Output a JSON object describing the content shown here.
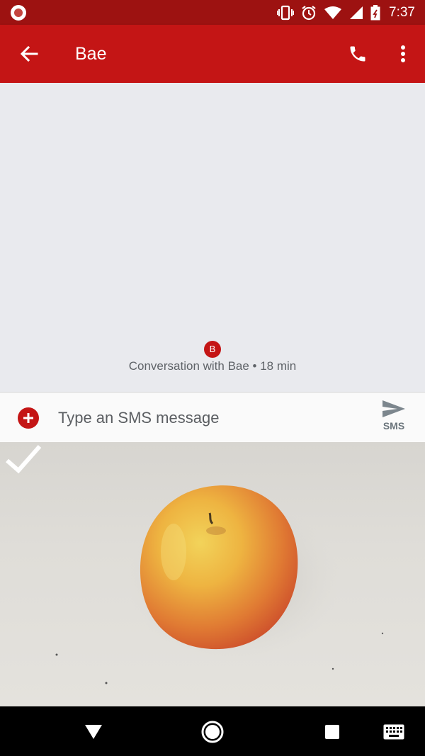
{
  "status_bar": {
    "time": "7:37",
    "icons": [
      "notification-dot-icon",
      "vibrate-icon",
      "alarm-icon",
      "wifi-icon",
      "signal-icon",
      "battery-icon"
    ]
  },
  "app_bar": {
    "title": "Bae",
    "color": "#c41515",
    "icons": [
      "back-arrow-icon",
      "phone-icon",
      "more-vert-icon"
    ]
  },
  "conversation": {
    "avatar_letter": "B",
    "info": "Conversation with Bae • 18 min"
  },
  "compose": {
    "placeholder": "Type an SMS message",
    "value": "",
    "send_label": "SMS",
    "icons": [
      "add-attachment-icon",
      "send-icon"
    ]
  },
  "camera": {
    "icons": [
      "checkmark-icon"
    ]
  },
  "nav_bar": {
    "icons": [
      "back-triangle-icon",
      "home-circle-icon",
      "recents-square-icon",
      "keyboard-icon"
    ]
  }
}
